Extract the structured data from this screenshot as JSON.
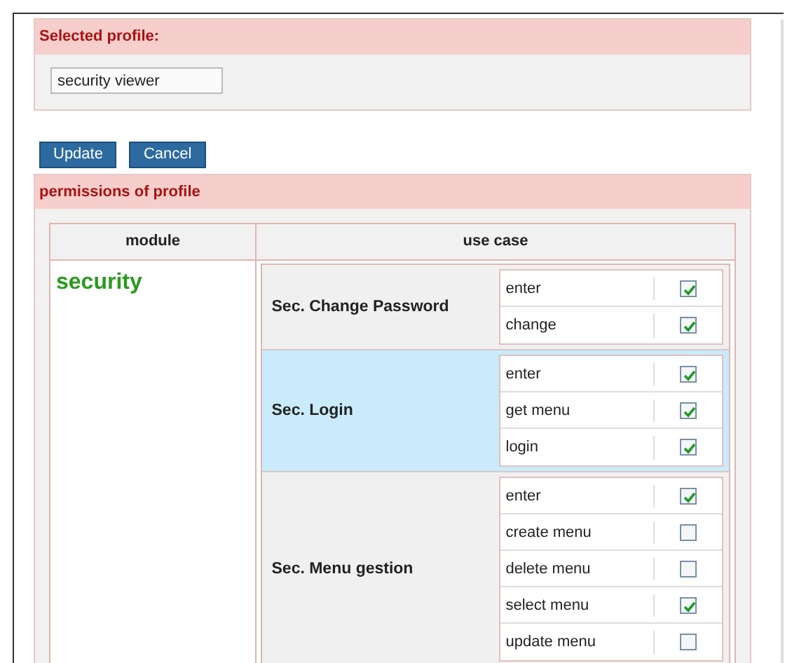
{
  "selected_profile": {
    "title": "Selected profile:",
    "value": "security viewer"
  },
  "buttons": [
    "Update",
    "Cancel"
  ],
  "permissions": {
    "title": "permissions of profile",
    "columns": [
      "module",
      "use case"
    ],
    "module": "security",
    "use_cases": [
      {
        "name": "Sec. Change Password",
        "actions": [
          {
            "label": "enter",
            "checked": true
          },
          {
            "label": "change",
            "checked": true
          }
        ]
      },
      {
        "name": "Sec. Login",
        "actions": [
          {
            "label": "enter",
            "checked": true
          },
          {
            "label": "get menu",
            "checked": true
          },
          {
            "label": "login",
            "checked": true
          }
        ]
      },
      {
        "name": "Sec. Menu gestion",
        "actions": [
          {
            "label": "enter",
            "checked": true
          },
          {
            "label": "create menu",
            "checked": false
          },
          {
            "label": "delete menu",
            "checked": false
          },
          {
            "label": "select menu",
            "checked": true
          },
          {
            "label": "update menu",
            "checked": false
          }
        ]
      }
    ]
  }
}
